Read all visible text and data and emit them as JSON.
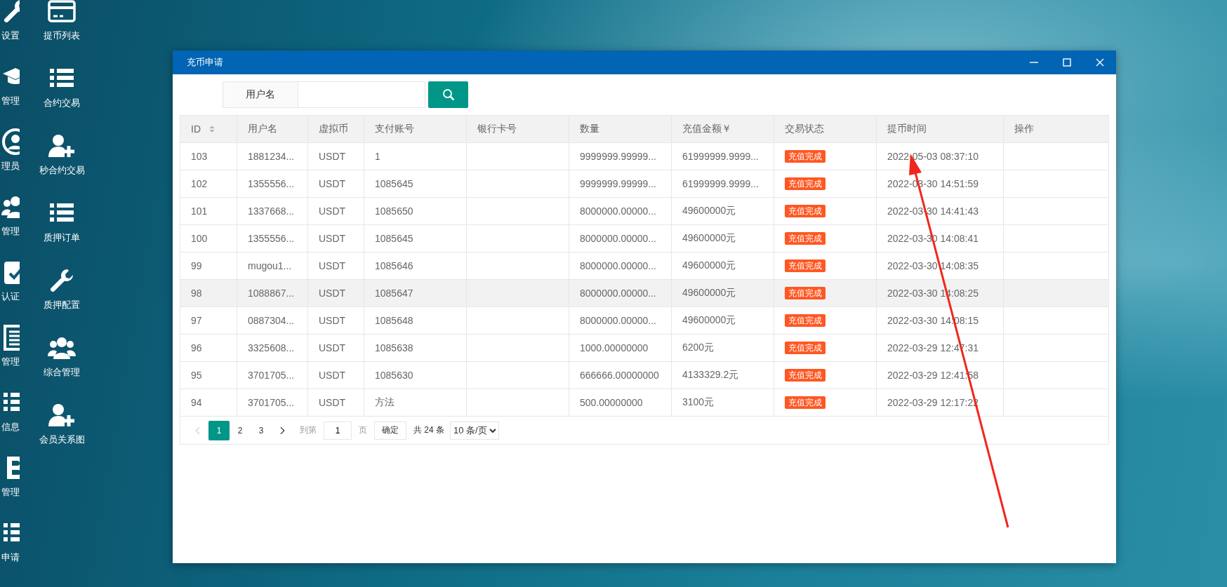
{
  "desktop": {
    "left_column": [
      {
        "label": "设置",
        "kind": "wrench"
      },
      {
        "label": "管理",
        "kind": "cap"
      },
      {
        "label": "理员",
        "kind": "user-circle"
      },
      {
        "label": "管理",
        "kind": "group"
      },
      {
        "label": "认证",
        "kind": "edit"
      },
      {
        "label": "管理",
        "kind": "document"
      },
      {
        "label": "信息",
        "kind": "list"
      },
      {
        "label": "管理",
        "kind": "bitcoin"
      },
      {
        "label": "申请",
        "kind": "list"
      }
    ],
    "right_column": [
      {
        "label": "提币列表",
        "kind": "card"
      },
      {
        "label": "合约交易",
        "kind": "list"
      },
      {
        "label": "秒合约交易",
        "kind": "user-plus"
      },
      {
        "label": "质押订单",
        "kind": "list"
      },
      {
        "label": "质押配置",
        "kind": "wrench"
      },
      {
        "label": "综合管理",
        "kind": "group"
      },
      {
        "label": "会员关系图",
        "kind": "user-plus"
      }
    ]
  },
  "window": {
    "title": "充币申请",
    "search": {
      "label": "用户名"
    },
    "table": {
      "columns": [
        {
          "label": "ID",
          "sortable": true
        },
        {
          "label": "用户名",
          "sortable": false
        },
        {
          "label": "虚拟币",
          "sortable": false
        },
        {
          "label": "支付账号",
          "sortable": false
        },
        {
          "label": "银行卡号",
          "sortable": false
        },
        {
          "label": "数量",
          "sortable": false
        },
        {
          "label": "充值金额￥",
          "sortable": false
        },
        {
          "label": "交易状态",
          "sortable": false
        },
        {
          "label": "提币时间",
          "sortable": false
        },
        {
          "label": "操作",
          "sortable": false
        }
      ],
      "rows": [
        {
          "id": "103",
          "username": "1881234...",
          "coin": "USDT",
          "account": "1",
          "quantity": "9999999.99999...",
          "amount": "61999999.9999...",
          "status": "充值完成",
          "time": "2022-05-03 08:37:10",
          "highlighted": false
        },
        {
          "id": "102",
          "username": "1355556...",
          "coin": "USDT",
          "account": "1085645",
          "quantity": "9999999.99999...",
          "amount": "61999999.9999...",
          "status": "充值完成",
          "time": "2022-03-30 14:51:59",
          "highlighted": false
        },
        {
          "id": "101",
          "username": "1337668...",
          "coin": "USDT",
          "account": "1085650",
          "quantity": "8000000.00000...",
          "amount": "49600000元",
          "status": "充值完成",
          "time": "2022-03-30 14:41:43",
          "highlighted": false
        },
        {
          "id": "100",
          "username": "1355556...",
          "coin": "USDT",
          "account": "1085645",
          "quantity": "8000000.00000...",
          "amount": "49600000元",
          "status": "充值完成",
          "time": "2022-03-30 14:08:41",
          "highlighted": false
        },
        {
          "id": "99",
          "username": "mugou1...",
          "coin": "USDT",
          "account": "1085646",
          "quantity": "8000000.00000...",
          "amount": "49600000元",
          "status": "充值完成",
          "time": "2022-03-30 14:08:35",
          "highlighted": false
        },
        {
          "id": "98",
          "username": "1088867...",
          "coin": "USDT",
          "account": "1085647",
          "quantity": "8000000.00000...",
          "amount": "49600000元",
          "status": "充值完成",
          "time": "2022-03-30 14:08:25",
          "highlighted": true
        },
        {
          "id": "97",
          "username": "0887304...",
          "coin": "USDT",
          "account": "1085648",
          "quantity": "8000000.00000...",
          "amount": "49600000元",
          "status": "充值完成",
          "time": "2022-03-30 14:08:15",
          "highlighted": false
        },
        {
          "id": "96",
          "username": "3325608...",
          "coin": "USDT",
          "account": "1085638",
          "quantity": "1000.00000000",
          "amount": "6200元",
          "status": "充值完成",
          "time": "2022-03-29 12:47:31",
          "highlighted": false
        },
        {
          "id": "95",
          "username": "3701705...",
          "coin": "USDT",
          "account": "1085630",
          "quantity": "666666.00000000",
          "amount": "4133329.2元",
          "status": "充值完成",
          "time": "2022-03-29 12:41:58",
          "highlighted": false
        },
        {
          "id": "94",
          "username": "3701705...",
          "coin": "USDT",
          "account": "方法",
          "quantity": "500.00000000",
          "amount": "3100元",
          "status": "充值完成",
          "time": "2022-03-29 12:17:22",
          "highlighted": false
        }
      ]
    },
    "pagination": {
      "prev_disabled": true,
      "next_disabled": false,
      "pages": [
        {
          "label": "1",
          "selected": true
        },
        {
          "label": "2",
          "selected": false
        },
        {
          "label": "3",
          "selected": false
        }
      ],
      "goto_label": "到第",
      "page_value": "1",
      "page_unit": "页",
      "confirm": "确定",
      "total": "共 24 条",
      "page_size": "10 条/页"
    }
  },
  "annotations": [
    {
      "kind": "arrow"
    }
  ]
}
